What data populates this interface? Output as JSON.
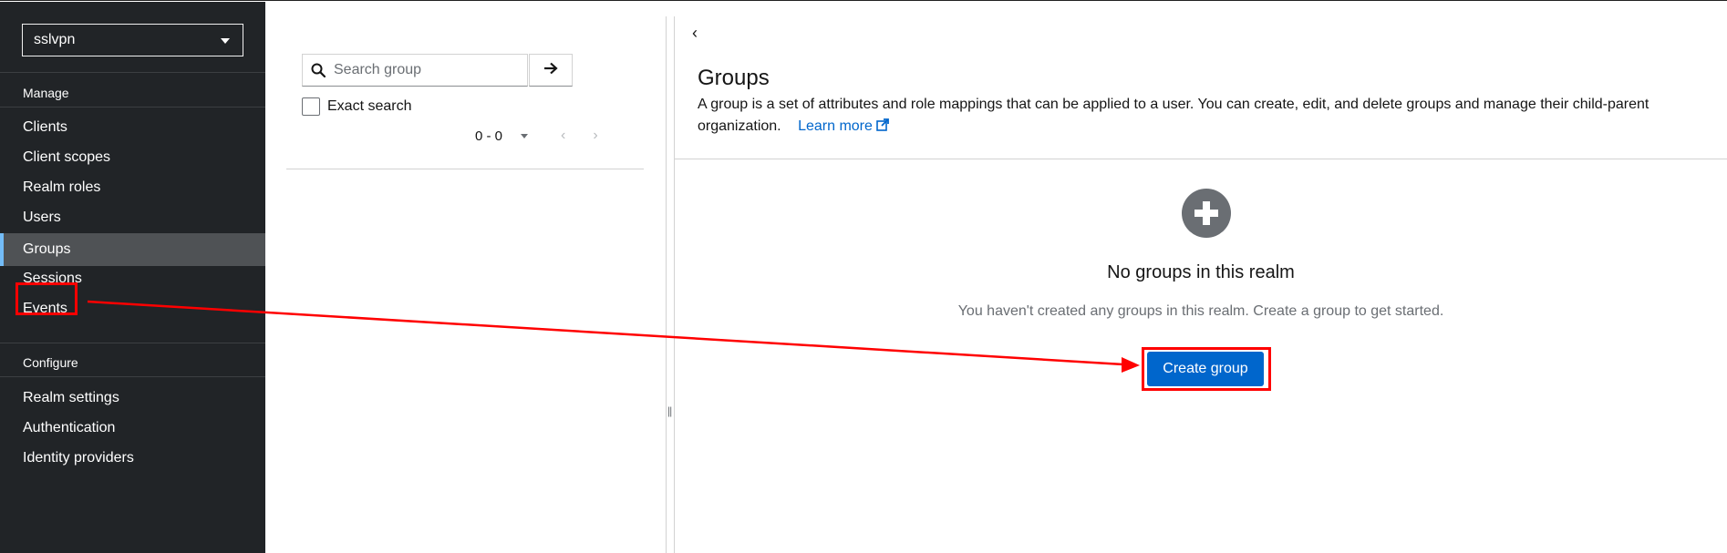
{
  "sidebar": {
    "realm": "sslvpn",
    "section_manage": "Manage",
    "manage_items": [
      "Clients",
      "Client scopes",
      "Realm roles",
      "Users",
      "Groups",
      "Sessions",
      "Events"
    ],
    "active_item": "Groups",
    "section_configure": "Configure",
    "configure_items": [
      "Realm settings",
      "Authentication",
      "Identity providers"
    ]
  },
  "tree": {
    "search_placeholder": "Search group",
    "exact_search_label": "Exact search",
    "pagination": "0 - 0"
  },
  "main": {
    "title": "Groups",
    "description": "A group is a set of attributes and role mappings that can be applied to a user. You can create, edit, and delete groups and manage their child-parent organization.",
    "learn_more": "Learn more",
    "empty_title": "No groups in this realm",
    "empty_body": "You haven't created any groups in this realm. Create a group to get started.",
    "create_button": "Create group"
  },
  "colors": {
    "sidebar_bg": "#212427",
    "primary": "#0066cc",
    "annotation": "#ff0000"
  }
}
